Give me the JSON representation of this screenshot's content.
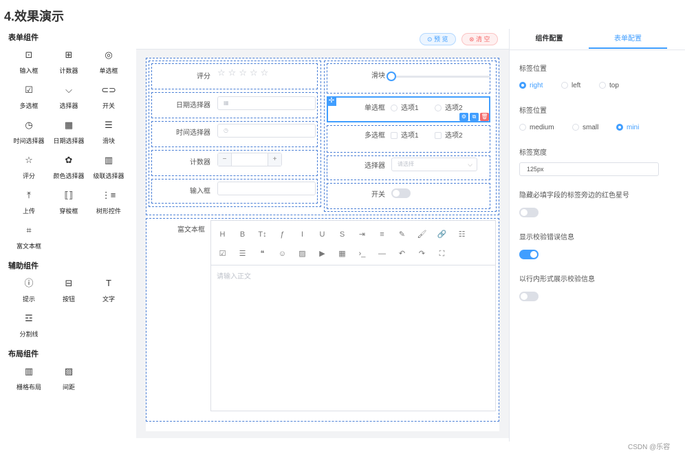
{
  "page_title": "4.效果演示",
  "palette": {
    "groups": [
      {
        "title": "表单组件",
        "items": [
          {
            "icon": "input-box",
            "glyph": "⊡",
            "label": "输入框"
          },
          {
            "icon": "counter",
            "glyph": "⊞",
            "label": "计数器"
          },
          {
            "icon": "radio",
            "glyph": "◎",
            "label": "单选框"
          },
          {
            "icon": "checkbox",
            "glyph": "☑",
            "label": "多选框"
          },
          {
            "icon": "select",
            "glyph": "⌵",
            "label": "选择器"
          },
          {
            "icon": "switch",
            "glyph": "⊂⊃",
            "label": "开关"
          },
          {
            "icon": "clock",
            "glyph": "◷",
            "label": "时间选择器"
          },
          {
            "icon": "calendar",
            "glyph": "▦",
            "label": "日期选择器"
          },
          {
            "icon": "slider",
            "glyph": "☰",
            "label": "滑块"
          },
          {
            "icon": "star",
            "glyph": "☆",
            "label": "评分"
          },
          {
            "icon": "palette",
            "glyph": "✿",
            "label": "颜色选择器"
          },
          {
            "icon": "cascader",
            "glyph": "▥",
            "label": "级联选择器"
          },
          {
            "icon": "upload",
            "glyph": "⤒",
            "label": "上传"
          },
          {
            "icon": "transfer",
            "glyph": "⟦⟧",
            "label": "穿梭框"
          },
          {
            "icon": "tree",
            "glyph": "⋮≡",
            "label": "树形控件"
          },
          {
            "icon": "rich-text",
            "glyph": "⌗",
            "label": "富文本框"
          }
        ]
      },
      {
        "title": "辅助组件",
        "items": [
          {
            "icon": "info",
            "glyph": "ⓘ",
            "label": "提示"
          },
          {
            "icon": "button",
            "glyph": "⊟",
            "label": "按钮"
          },
          {
            "icon": "text",
            "glyph": "T",
            "label": "文字"
          },
          {
            "icon": "divider",
            "glyph": "☲",
            "label": "分割线"
          }
        ]
      },
      {
        "title": "布局组件",
        "items": [
          {
            "icon": "grid",
            "glyph": "▥",
            "label": "栅格布局"
          },
          {
            "icon": "spacing",
            "glyph": "▨",
            "label": "间距"
          }
        ]
      }
    ]
  },
  "toolbar": {
    "preview": "⊙ 预 览",
    "clear": "⊗ 清 空"
  },
  "form": {
    "rating_label": "评分",
    "rating_value": 0,
    "date_label": "日期选择器",
    "time_label": "时间选择器",
    "counter_label": "计数器",
    "input_label": "输入框",
    "slider_label": "滑块",
    "slider_value": 0,
    "radio_label": "单选框",
    "radio_opt1": "选项1",
    "radio_opt2": "选项2",
    "checkbox_label": "多选框",
    "checkbox_opt1": "选项1",
    "checkbox_opt2": "选项2",
    "select_label": "选择器",
    "select_placeholder": "请选择",
    "switch_label": "开关",
    "richtext_label": "富文本框",
    "richtext_placeholder": "请输入正文",
    "counter_minus": "−",
    "counter_plus": "+"
  },
  "rte_toolbar_row1": [
    "H",
    "B",
    "T↕",
    "ƒ",
    "I",
    "U",
    "S",
    "⇥",
    "≡",
    "✎",
    "🖌",
    "🔗",
    "☷"
  ],
  "rte_toolbar_row2": [
    "☑",
    "☰",
    "❝",
    "☺",
    "▨",
    "▶",
    "▦",
    "›_",
    "—",
    "↶",
    "↷",
    "⛶"
  ],
  "right_panel": {
    "tab1": "组件配置",
    "tab2": "表单配置",
    "label_position_title": "标签位置",
    "label_position_opts": [
      "right",
      "left",
      "top"
    ],
    "label_position_selected": "right",
    "size_title": "标签位置",
    "size_opts": [
      "medium",
      "small",
      "mini"
    ],
    "size_selected": "mini",
    "label_width_title": "标签宽度",
    "label_width_value": "125px",
    "hide_required_title": "隐藏必填字段的标签旁边的红色星号",
    "hide_required_on": false,
    "show_error_title": "显示校验错误信息",
    "show_error_on": true,
    "inline_error_title": "以行内形式展示校验信息",
    "inline_error_on": false
  },
  "watermark": "CSDN @乐容",
  "colors": {
    "accent": "#409eff",
    "danger": "#f56c6c",
    "dashed": "#4a7fd6"
  }
}
